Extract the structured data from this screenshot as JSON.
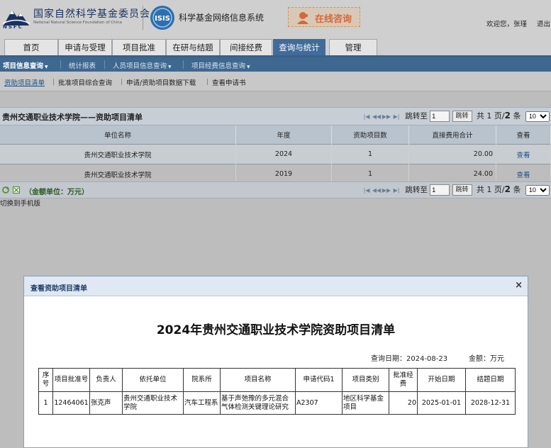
{
  "header": {
    "org_name": "国家自然科学基金委员会",
    "org_name_en": "National Natural Science Foundation of China",
    "org_abbr": "NSFC",
    "system_logo": "ISIS",
    "system_name": "科学基金网络信息系统",
    "consult_label": "在线咨询",
    "welcome": "欢迎您，张瑾",
    "logout": "退出"
  },
  "tabs": [
    {
      "label": "首页"
    },
    {
      "label": "申请与受理"
    },
    {
      "label": "项目批准"
    },
    {
      "label": "在研与结题"
    },
    {
      "label": "间接经费"
    },
    {
      "label": "查询与统计",
      "active": true
    },
    {
      "label": "管理"
    }
  ],
  "subnav": [
    {
      "label": "项目信息查询",
      "active": true
    },
    {
      "label": "统计报表"
    },
    {
      "label": "人员项目信息查询"
    },
    {
      "label": "项目经费信息查询"
    }
  ],
  "nav3": [
    {
      "label": "资助项目清单",
      "active": true
    },
    {
      "label": "批准项目综合查询"
    },
    {
      "label": "申请/资助项目数据下载"
    },
    {
      "label": "查看申请书"
    }
  ],
  "list": {
    "title": "贵州交通职业技术学院——资助项目清单",
    "pager": {
      "jump_label": "跳转至",
      "page_input": "1",
      "go_label": "跳转",
      "total_prefix": "共",
      "current": "1",
      "separator": "页/",
      "total": "2",
      "suffix": "条",
      "page_size": "10"
    },
    "columns": [
      "单位名称",
      "年度",
      "资助项目数",
      "直接费用合计",
      "查看"
    ],
    "rows": [
      {
        "unit": "贵州交通职业技术学院",
        "year": "2024",
        "count": "1",
        "amount": "20.00",
        "view": "查看"
      },
      {
        "unit": "贵州交通职业技术学院",
        "year": "2019",
        "count": "1",
        "amount": "24.00",
        "view": "查看"
      }
    ],
    "unit_note": "（金额单位：万元）",
    "mobile_link": "切换到手机版"
  },
  "modal": {
    "title": "查看资助项目清单",
    "close": "×",
    "doc_title": "2024年贵州交通职业技术学院资助项目清单",
    "query_date": "查询日期：2024-08-23",
    "amount_unit": "金额：万元",
    "columns": [
      "序号",
      "项目批准号",
      "负责人",
      "依托单位",
      "院系所",
      "项目名称",
      "申请代码1",
      "项目类别",
      "批准经费",
      "开始日期",
      "结题日期"
    ],
    "rows": [
      {
        "no": "1",
        "approval_no": "12464061",
        "leader": "张克声",
        "institution": "贵州交通职业技术学院",
        "department": "汽车工程系",
        "project_name": "基于声弛豫的多元混合气体检测关键理论研究",
        "code": "A2307",
        "category": "地区科学基金项目",
        "funding": "20",
        "start": "2025-01-01",
        "end": "2028-12-31"
      }
    ]
  },
  "colors": {
    "nav_blue": "#3f6891",
    "active_tab": "#416b9a",
    "link_blue": "#1e4f88",
    "consult_text": "#d4683a"
  }
}
